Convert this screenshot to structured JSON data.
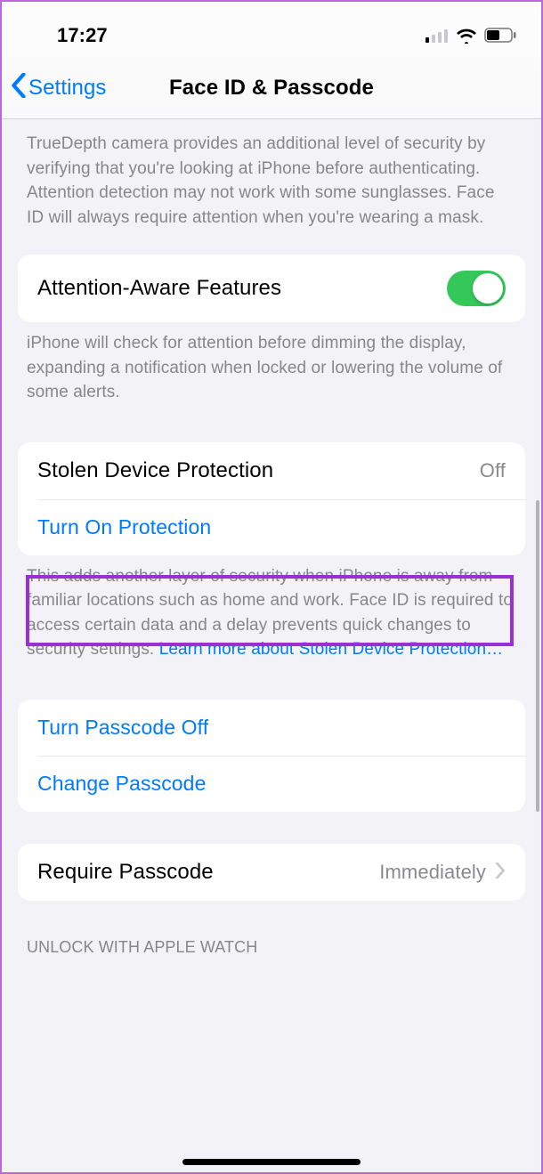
{
  "status": {
    "time": "17:27"
  },
  "nav": {
    "back_label": "Settings",
    "title": "Face ID & Passcode"
  },
  "sections": {
    "truedepth_footer": "TrueDepth camera provides an additional level of security by verifying that you're looking at iPhone before authenticating. Attention detection may not work with some sunglasses. Face ID will always require attention when you're wearing a mask.",
    "attention_aware": {
      "label": "Attention-Aware Features",
      "on": true,
      "footer": "iPhone will check for attention before dimming the display, expanding a notification when locked or lowering the volume of some alerts."
    },
    "stolen_device": {
      "title": "Stolen Device Protection",
      "value": "Off",
      "action": "Turn On Protection",
      "footer_pre": "This adds another layer of security when iPhone is away from familiar locations such as home and work. Face ID is required to access certain data and a delay prevents quick changes to security settings. ",
      "footer_link": "Learn more about Stolen Device Protection…"
    },
    "passcode_actions": {
      "turn_off": "Turn Passcode Off",
      "change": "Change Passcode"
    },
    "require_passcode": {
      "label": "Require Passcode",
      "value": "Immediately"
    },
    "unlock_watch_header": "UNLOCK WITH APPLE WATCH"
  }
}
